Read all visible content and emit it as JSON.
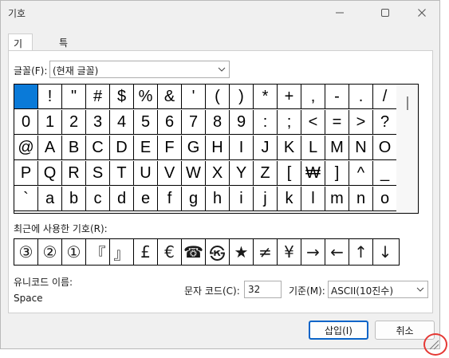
{
  "window": {
    "title": "기호",
    "minimize_icon": "minimize-icon",
    "maximize_icon": "maximize-icon",
    "close_icon": "close-icon"
  },
  "tabs": [
    {
      "label": "기호(S)",
      "active": true
    },
    {
      "label": "특수 문자(P)",
      "active": false
    }
  ],
  "font": {
    "label": "글꼴(F):",
    "value": "(현재 글꼴)"
  },
  "symbols": {
    "rows": [
      [
        " ",
        "!",
        "\"",
        "#",
        "$",
        "%",
        "&",
        "'",
        "(",
        ")",
        "*",
        "+",
        ",",
        "-",
        ".",
        "/"
      ],
      [
        "0",
        "1",
        "2",
        "3",
        "4",
        "5",
        "6",
        "7",
        "8",
        "9",
        ":",
        ";",
        "<",
        "=",
        ">",
        "?"
      ],
      [
        "@",
        "A",
        "B",
        "C",
        "D",
        "E",
        "F",
        "G",
        "H",
        "I",
        "J",
        "K",
        "L",
        "M",
        "N",
        "O"
      ],
      [
        "P",
        "Q",
        "R",
        "S",
        "T",
        "U",
        "V",
        "W",
        "X",
        "Y",
        "Z",
        "[",
        "₩",
        "]",
        "^",
        "_"
      ],
      [
        "`",
        "a",
        "b",
        "c",
        "d",
        "e",
        "f",
        "g",
        "h",
        "i",
        "j",
        "k",
        "l",
        "m",
        "n",
        "o"
      ]
    ],
    "selected": [
      0,
      0
    ]
  },
  "recent": {
    "label": "최근에 사용한 기호(R):",
    "items": [
      "③",
      "②",
      "①",
      "『",
      "』",
      "£",
      "€",
      "☎",
      "㉿",
      "★",
      "≠",
      "¥",
      "→",
      "←",
      "↑",
      "↓"
    ]
  },
  "unicode_name": {
    "label": "유니코드 이름:",
    "value": "Space"
  },
  "char_code": {
    "label": "문자 코드(C):",
    "value": "32"
  },
  "basis": {
    "label": "기준(M):",
    "value": "ASCII(10진수)"
  },
  "buttons": {
    "insert": "삽입(I)",
    "cancel": "취소"
  },
  "colors": {
    "selection": "#0a7ad8",
    "primary_border": "#0a64c8",
    "highlight_circle": "#e53935"
  }
}
